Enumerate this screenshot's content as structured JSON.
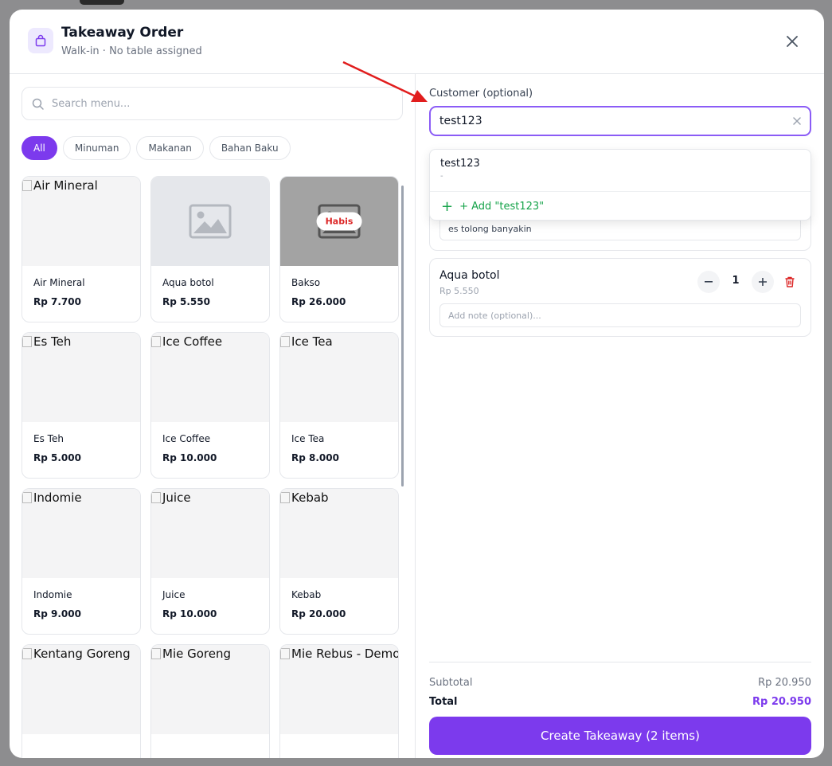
{
  "header": {
    "title": "Takeaway Order",
    "subtitle": "Walk-in · No table assigned",
    "icon": "shopping-bag-icon"
  },
  "menu": {
    "search_placeholder": "Search menu...",
    "categories": [
      "All",
      "Minuman",
      "Makanan",
      "Bahan Baku"
    ],
    "active_category": "All",
    "items": [
      {
        "name": "Air Mineral",
        "price": "Rp 7.700",
        "image_alt": "Air Mineral"
      },
      {
        "name": "Aqua botol",
        "price": "Rp 5.550",
        "image_alt": ""
      },
      {
        "name": "Bakso",
        "price": "Rp 26.000",
        "badge": "Habis"
      },
      {
        "name": "Es Teh",
        "price": "Rp 5.000",
        "image_alt": "Es Teh"
      },
      {
        "name": "Ice Coffee",
        "price": "Rp 10.000",
        "image_alt": "Ice Coffee"
      },
      {
        "name": "Ice Tea",
        "price": "Rp 8.000",
        "image_alt": "Ice Tea"
      },
      {
        "name": "Indomie",
        "price": "Rp 9.000",
        "image_alt": "Indomie"
      },
      {
        "name": "Juice",
        "price": "Rp 10.000",
        "image_alt": "Juice"
      },
      {
        "name": "Kebab",
        "price": "Rp 20.000",
        "image_alt": "Kebab"
      },
      {
        "name": "",
        "price": "",
        "image_alt": "Kentang Goreng"
      },
      {
        "name": "",
        "price": "",
        "image_alt": "Mie Goreng"
      },
      {
        "name": "",
        "price": "",
        "image_alt": "Mie Rebus - Demo"
      }
    ]
  },
  "customer": {
    "label": "Customer (optional)",
    "value": "test123",
    "suggestion": {
      "name": "test123",
      "sub": "-"
    },
    "add_label": "+ Add \"test123\""
  },
  "cart": {
    "items": [
      {
        "name": "",
        "price": "",
        "qty": "",
        "note": "es tolong banyakin"
      },
      {
        "name": "Aqua botol",
        "price": "Rp 5.550",
        "qty": "1",
        "note": "",
        "note_placeholder": "Add note (optional)..."
      }
    ]
  },
  "summary": {
    "subtotal_label": "Subtotal",
    "subtotal_value": "Rp 20.950",
    "total_label": "Total",
    "total_value": "Rp 20.950",
    "create_button": "Create Takeaway (2 items)"
  },
  "colors": {
    "accent": "#7c3aed",
    "danger": "#dc2626",
    "success": "#16a34a",
    "annotation_arrow": "#e11d1d"
  }
}
